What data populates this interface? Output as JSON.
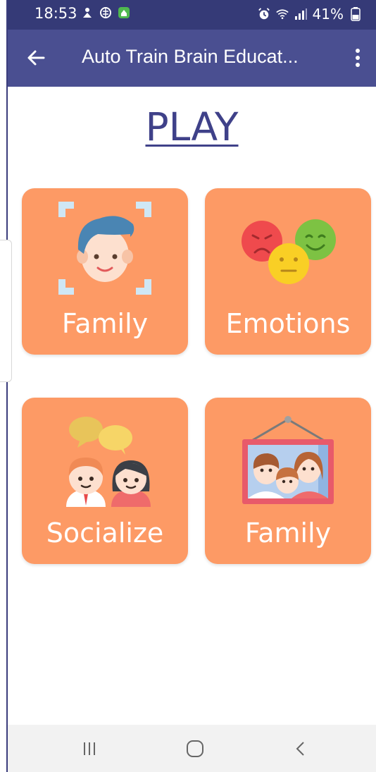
{
  "status_bar": {
    "time": "18:53",
    "battery": "41%"
  },
  "app_bar": {
    "title": "Auto Train Brain Educat..."
  },
  "page": {
    "title": "PLAY"
  },
  "cards": [
    {
      "label": "Family",
      "icon": "face-scan-icon"
    },
    {
      "label": "Emotions",
      "icon": "emotion-faces-icon"
    },
    {
      "label": "Socialize",
      "icon": "two-people-chat-icon"
    },
    {
      "label": "Family",
      "icon": "family-photo-frame-icon"
    }
  ],
  "colors": {
    "status_bar": "#353a77",
    "app_bar": "#4a4f91",
    "title": "#3f4189",
    "card": "#fd9a65"
  }
}
